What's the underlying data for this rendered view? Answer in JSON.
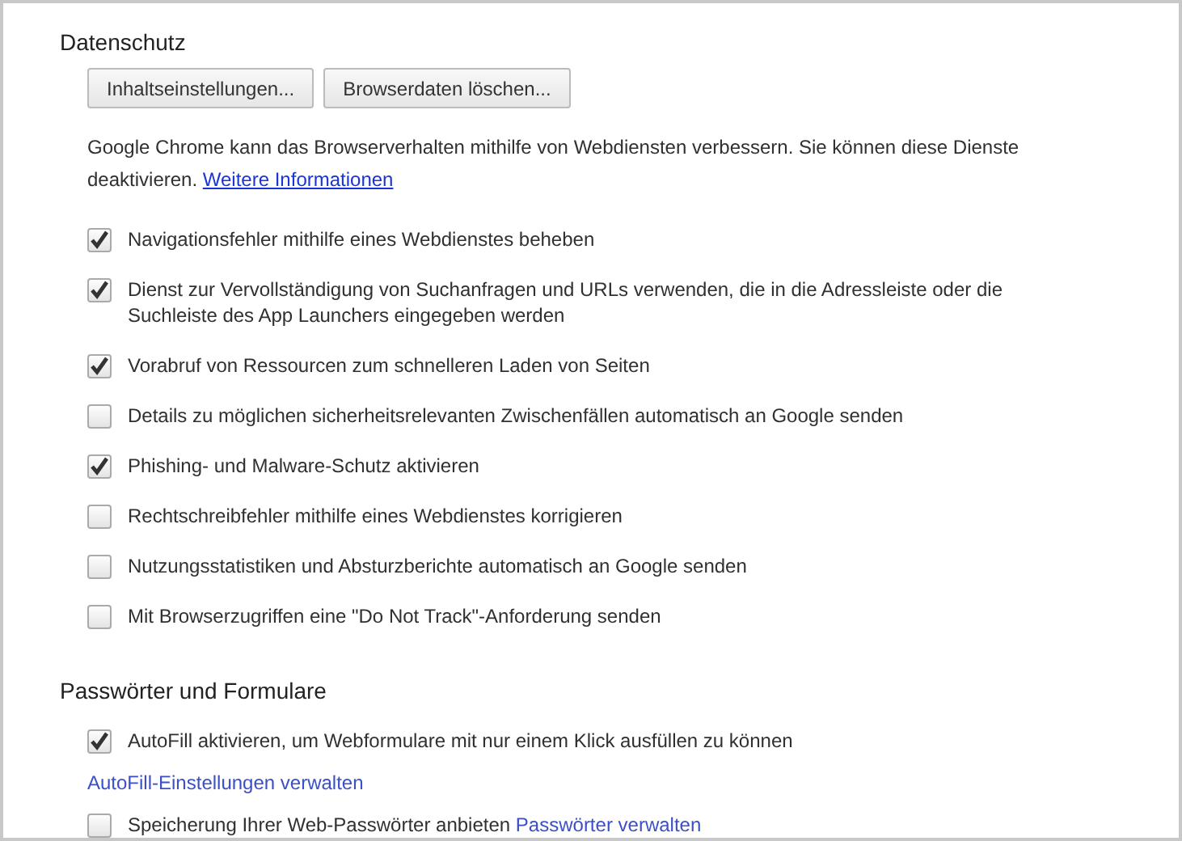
{
  "sections": [
    {
      "title": "Datenschutz",
      "items": [
        {
          "kind": "buttons",
          "buttons": [
            "Inhaltseinstellungen...",
            "Browserdaten löschen..."
          ]
        },
        {
          "kind": "description",
          "text": "Google Chrome kann das Browserverhalten mithilfe von Webdiensten verbessern. Sie können diese Dienste deaktivieren.",
          "link": "Weitere Informationen"
        },
        {
          "kind": "checkbox",
          "label": "Navigationsfehler mithilfe eines Webdienstes beheben",
          "checked": true
        },
        {
          "kind": "checkbox",
          "label": "Dienst zur Vervollständigung von Suchanfragen und URLs verwenden, die in die Adressleiste oder die Suchleiste des App Launchers eingegeben werden",
          "checked": true
        },
        {
          "kind": "checkbox",
          "label": "Vorabruf von Ressourcen zum schnelleren Laden von Seiten",
          "checked": true
        },
        {
          "kind": "checkbox",
          "label": "Details zu möglichen sicherheitsrelevanten Zwischenfällen automatisch an Google senden",
          "checked": false
        },
        {
          "kind": "checkbox",
          "label": "Phishing- und Malware-Schutz aktivieren",
          "checked": true
        },
        {
          "kind": "checkbox",
          "label": "Rechtschreibfehler mithilfe eines Webdienstes korrigieren",
          "checked": false
        },
        {
          "kind": "checkbox",
          "label": "Nutzungsstatistiken und Absturzberichte automatisch an Google senden",
          "checked": false
        },
        {
          "kind": "checkbox",
          "label": "Mit Browserzugriffen eine \"Do Not Track\"-Anforderung senden",
          "checked": false
        }
      ]
    },
    {
      "title": "Passwörter und Formulare",
      "items": [
        {
          "kind": "checkbox",
          "label": "AutoFill aktivieren, um Webformulare mit nur einem Klick ausfüllen zu können",
          "checked": true
        },
        {
          "kind": "link",
          "text": "AutoFill-Einstellungen verwalten"
        },
        {
          "kind": "checkbox",
          "label": "Speicherung Ihrer Web-Passwörter anbieten",
          "checked": false,
          "link": "Passwörter verwalten"
        }
      ]
    }
  ]
}
